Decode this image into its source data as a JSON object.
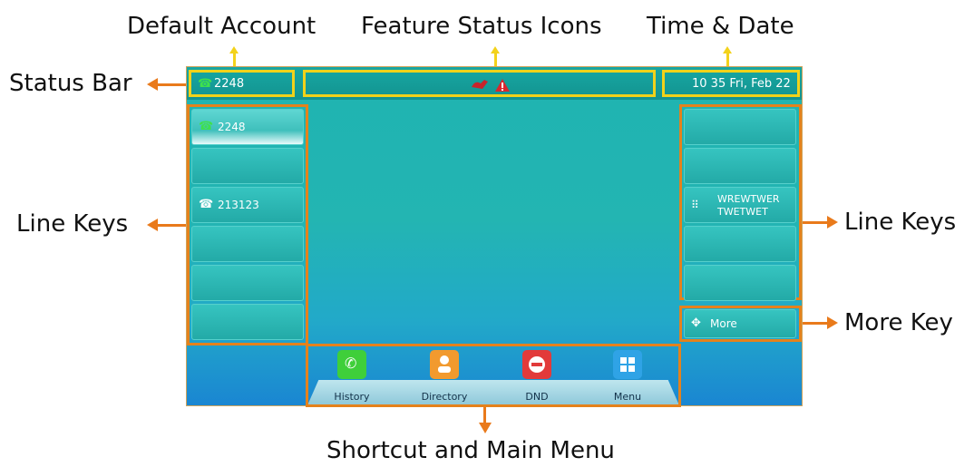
{
  "callouts": {
    "default_account": "Default Account",
    "feature_status_icons": "Feature Status Icons",
    "time_date": "Time & Date",
    "status_bar": "Status Bar",
    "line_keys_left": "Line Keys",
    "line_keys_right": "Line Keys",
    "more_key": "More Key",
    "shortcut_main_menu": "Shortcut and Main Menu"
  },
  "status_bar": {
    "account": "2248",
    "datetime": "10 35 Fri, Feb 22",
    "feature_icons": [
      "missed-call-icon",
      "warning-icon"
    ]
  },
  "left_line_keys": [
    {
      "label": "2248",
      "icon": "phone-green-icon",
      "active": true
    },
    {
      "label": "",
      "icon": ""
    },
    {
      "label": "213123",
      "icon": "phone-icon"
    },
    {
      "label": "",
      "icon": ""
    },
    {
      "label": "",
      "icon": ""
    },
    {
      "label": "",
      "icon": ""
    }
  ],
  "right_line_keys": [
    {
      "label": ""
    },
    {
      "label": ""
    },
    {
      "label_line1": "WREWTWER",
      "label_line2": "TWETWET",
      "icon": "keypad-icon"
    },
    {
      "label": ""
    },
    {
      "label": ""
    }
  ],
  "more_key": {
    "label": "More",
    "icon": "more-arrows-icon"
  },
  "shortcuts": [
    {
      "label": "History",
      "icon": "history-phone-icon",
      "color": "#3fcf3a"
    },
    {
      "label": "Directory",
      "icon": "contact-icon",
      "color": "#f29a2e"
    },
    {
      "label": "DND",
      "icon": "dnd-icon",
      "color": "#e23a3a"
    },
    {
      "label": "Menu",
      "icon": "grid-icon",
      "color": "#2fa3e6"
    }
  ],
  "colors": {
    "accent": "#e97a1b",
    "highlight": "#f1d21a",
    "screen": "#1fb3b1"
  }
}
